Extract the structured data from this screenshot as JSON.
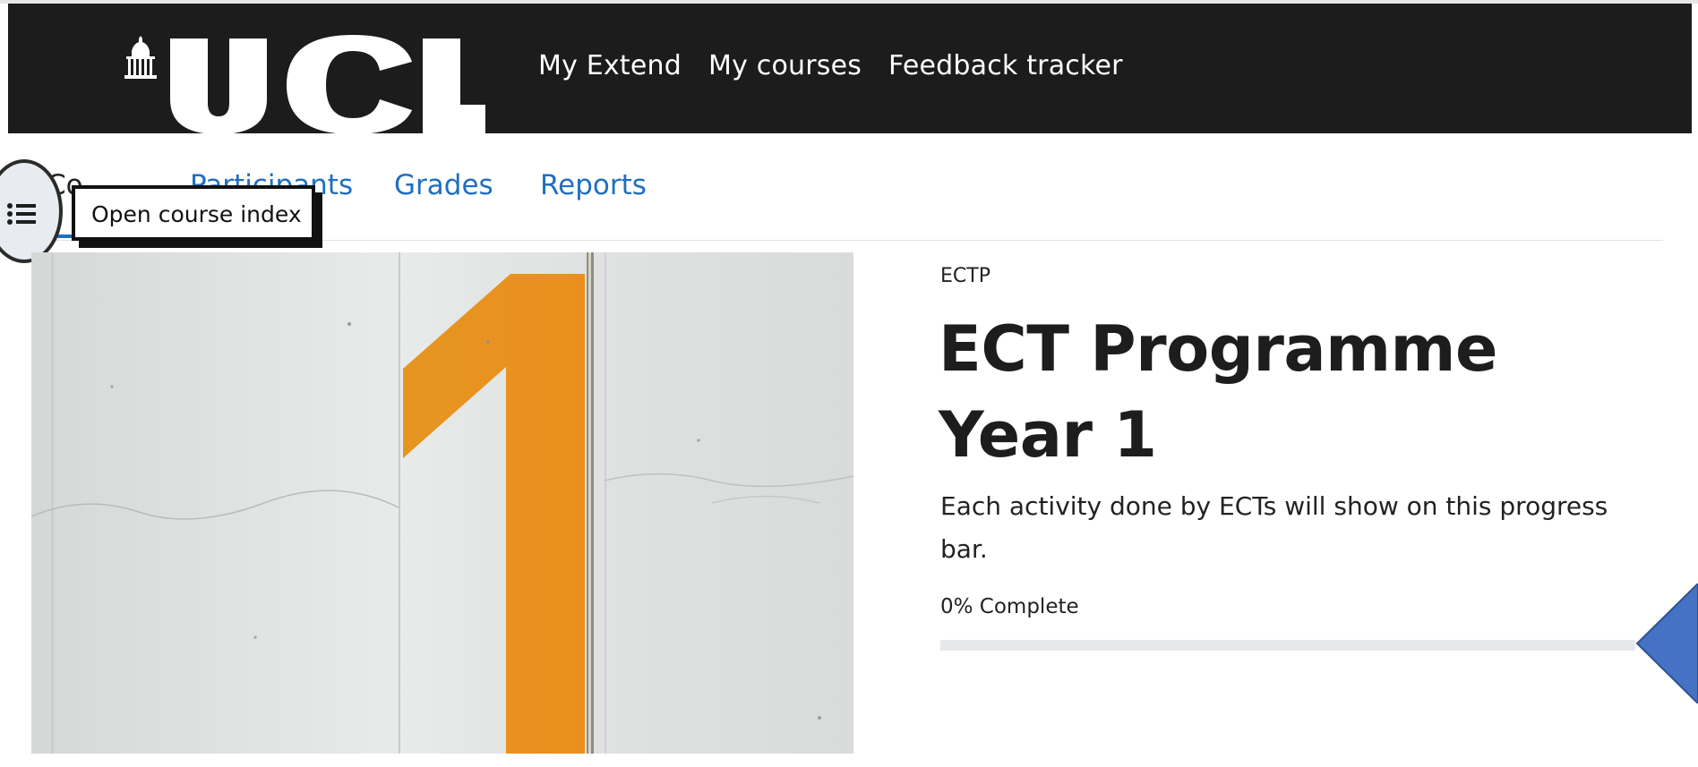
{
  "navbar": {
    "logo_text": "UCL",
    "links": {
      "my_extend": "My Extend",
      "my_courses": "My courses",
      "feedback_tracker": "Feedback tracker"
    }
  },
  "secondary_nav": {
    "course": "Co",
    "participants": "Participants",
    "grades": "Grades",
    "reports": "Reports"
  },
  "course_index": {
    "tooltip": "Open course index",
    "icon": "list-icon"
  },
  "course": {
    "shortname": "ECTP",
    "title": "ECT Programme Year 1",
    "description": "Each activity done by ECTs will show on this progress bar.",
    "progress_label": "0% Complete",
    "progress_fraction": 0
  },
  "colors": {
    "navbar_bg": "#1c1c1c",
    "link_blue": "#1f6fc1",
    "arrow_blue": "#4472c4",
    "number_orange": "#e8921f"
  }
}
